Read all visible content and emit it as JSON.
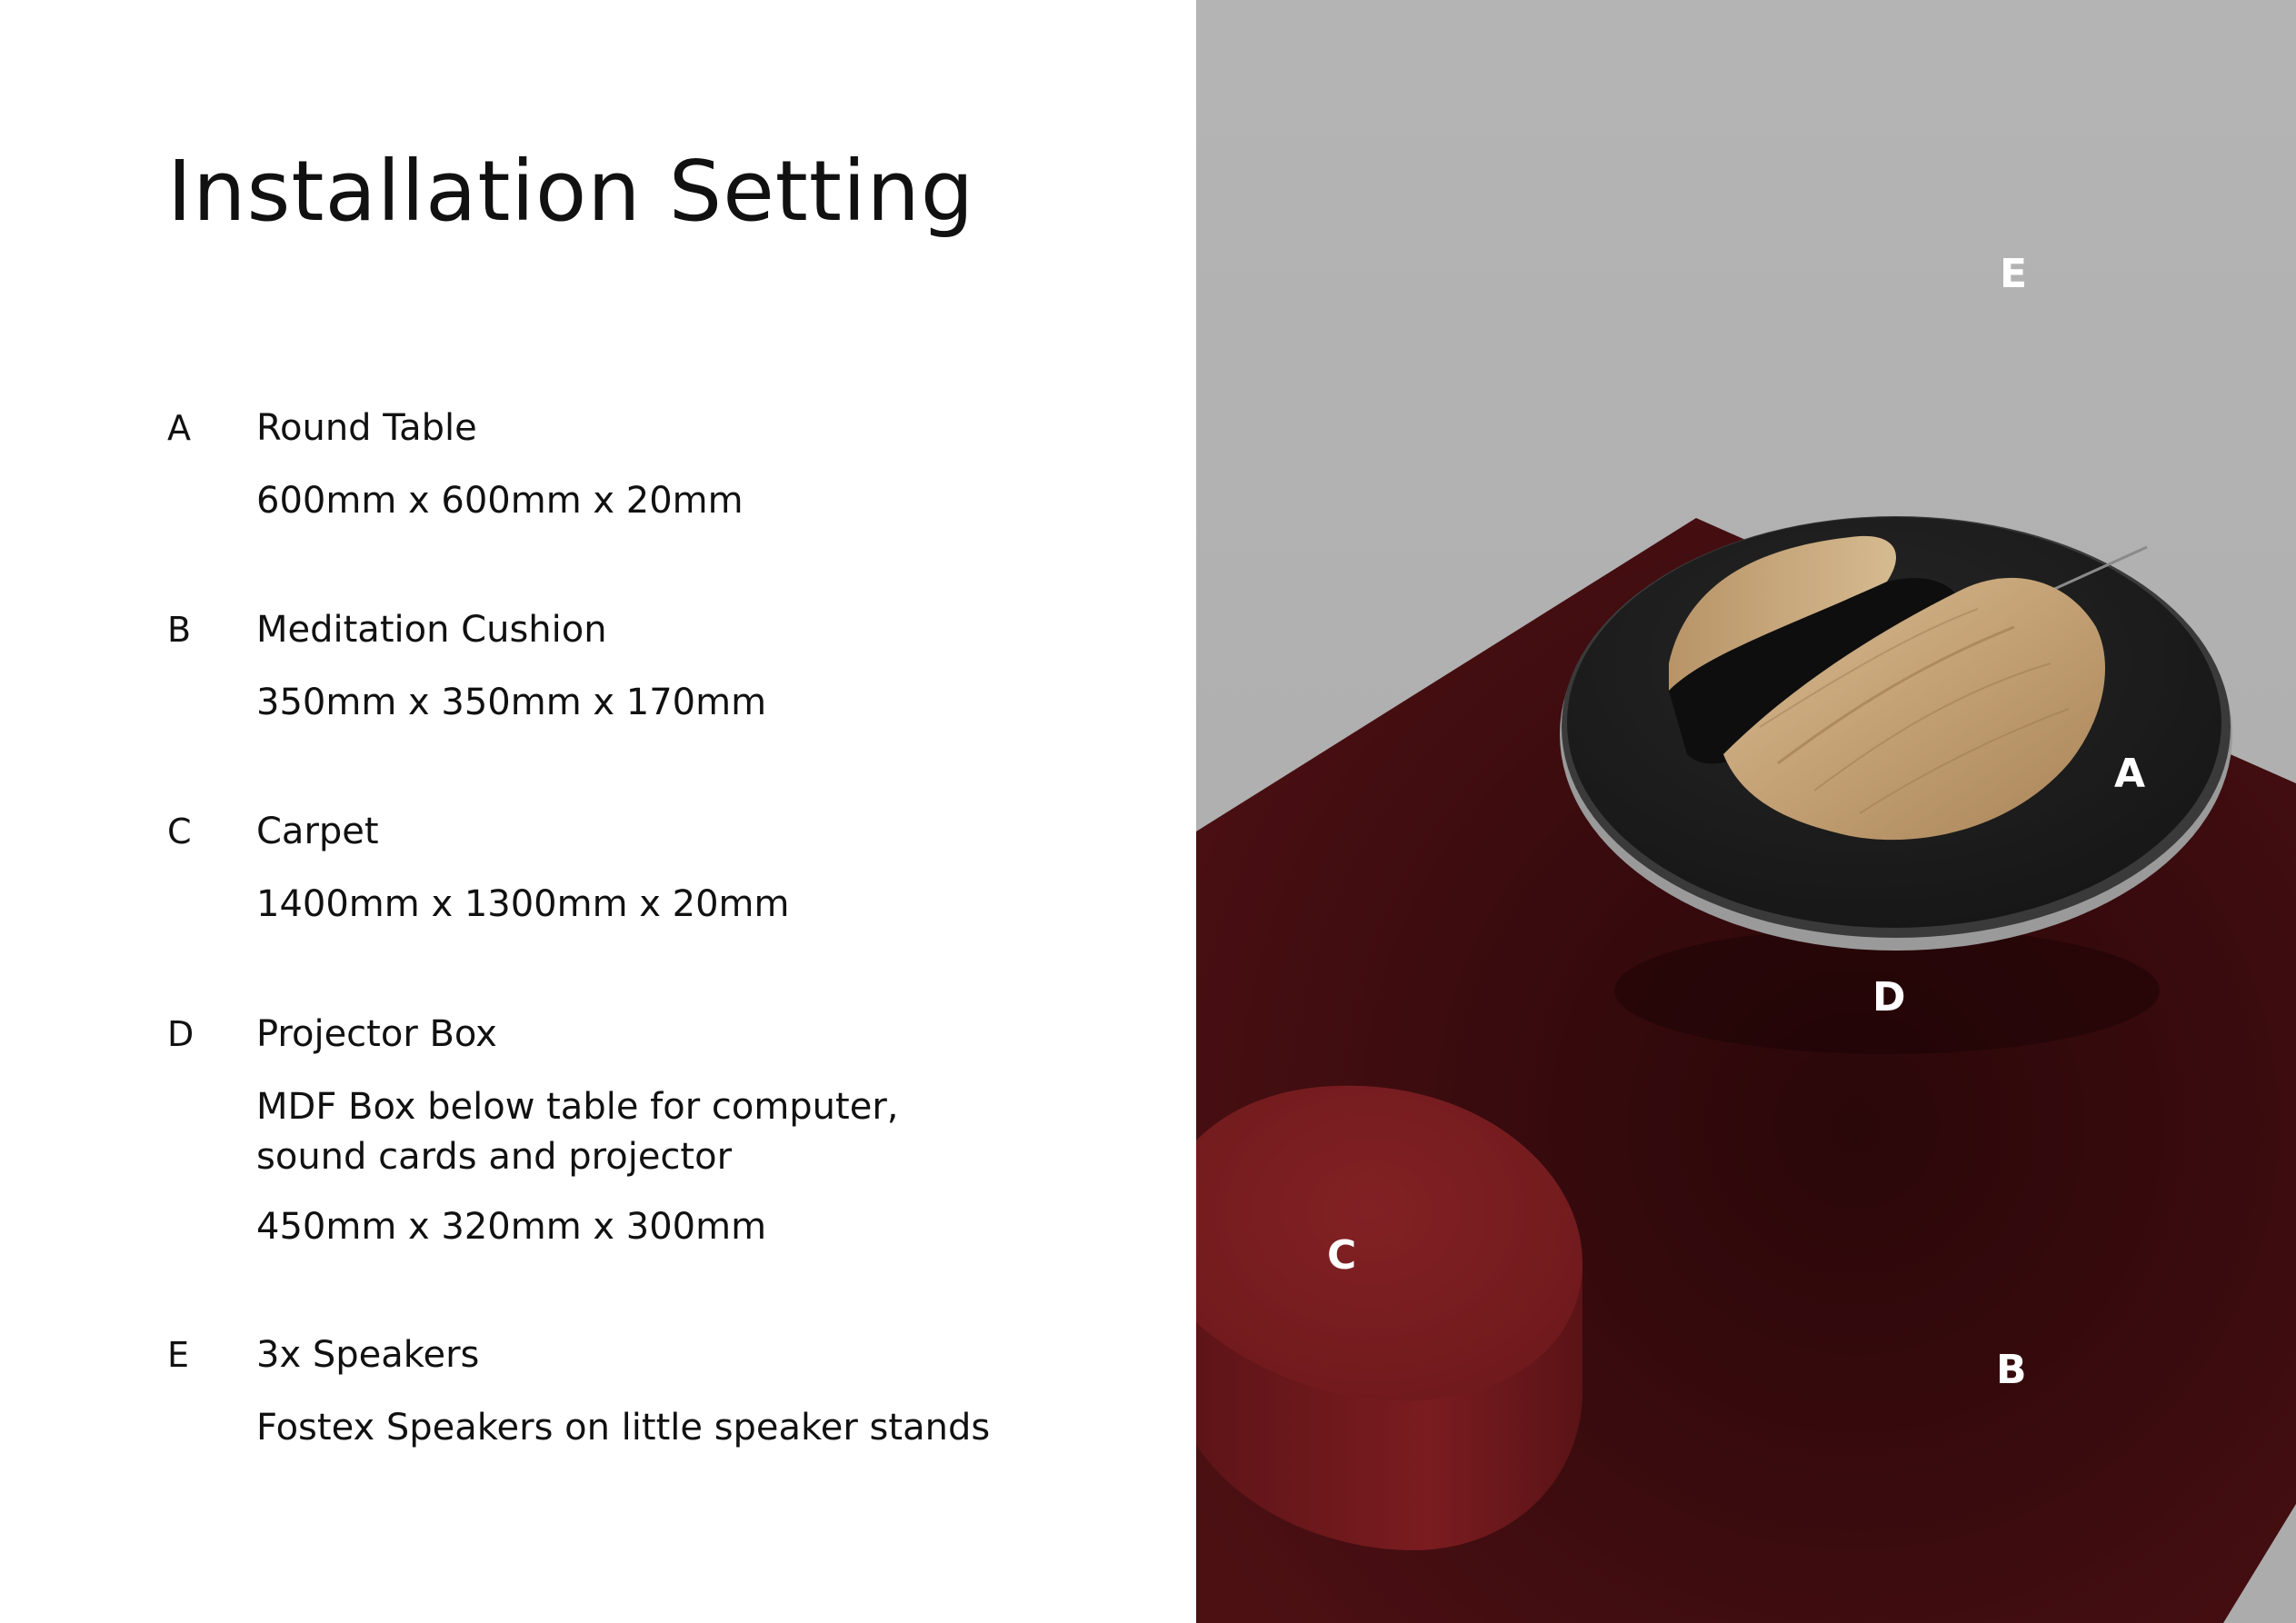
{
  "page": {
    "title": "Installation Setting"
  },
  "specs": [
    {
      "letter": "A",
      "name": "Round Table",
      "description": [],
      "dimensions": "600mm x 600mm x 20mm"
    },
    {
      "letter": "B",
      "name": "Meditation Cushion",
      "description": [],
      "dimensions": "350mm x 350mm x 170mm"
    },
    {
      "letter": "C",
      "name": "Carpet",
      "description": [],
      "dimensions": "1400mm x 1300mm x 20mm"
    },
    {
      "letter": "D",
      "name": "Projector Box",
      "description": [
        "MDF Box below table for computer,",
        "sound cards and projector"
      ],
      "dimensions": "450mm x 320mm x 300mm"
    },
    {
      "letter": "E",
      "name": "3x Speakers",
      "description": [],
      "dimensions": "Fostex Speakers on little speaker stands"
    }
  ],
  "render": {
    "callouts": {
      "a": "A",
      "b": "B",
      "c": "C",
      "d": "D",
      "e": "E"
    },
    "colors": {
      "wall": "#b2b2b2",
      "carpet": "#4a0f12",
      "table_top": "#1e1e1e",
      "table_rim": "#8f8f8f",
      "cushion": "#7b1d20",
      "wood": "#c9a77c"
    }
  }
}
